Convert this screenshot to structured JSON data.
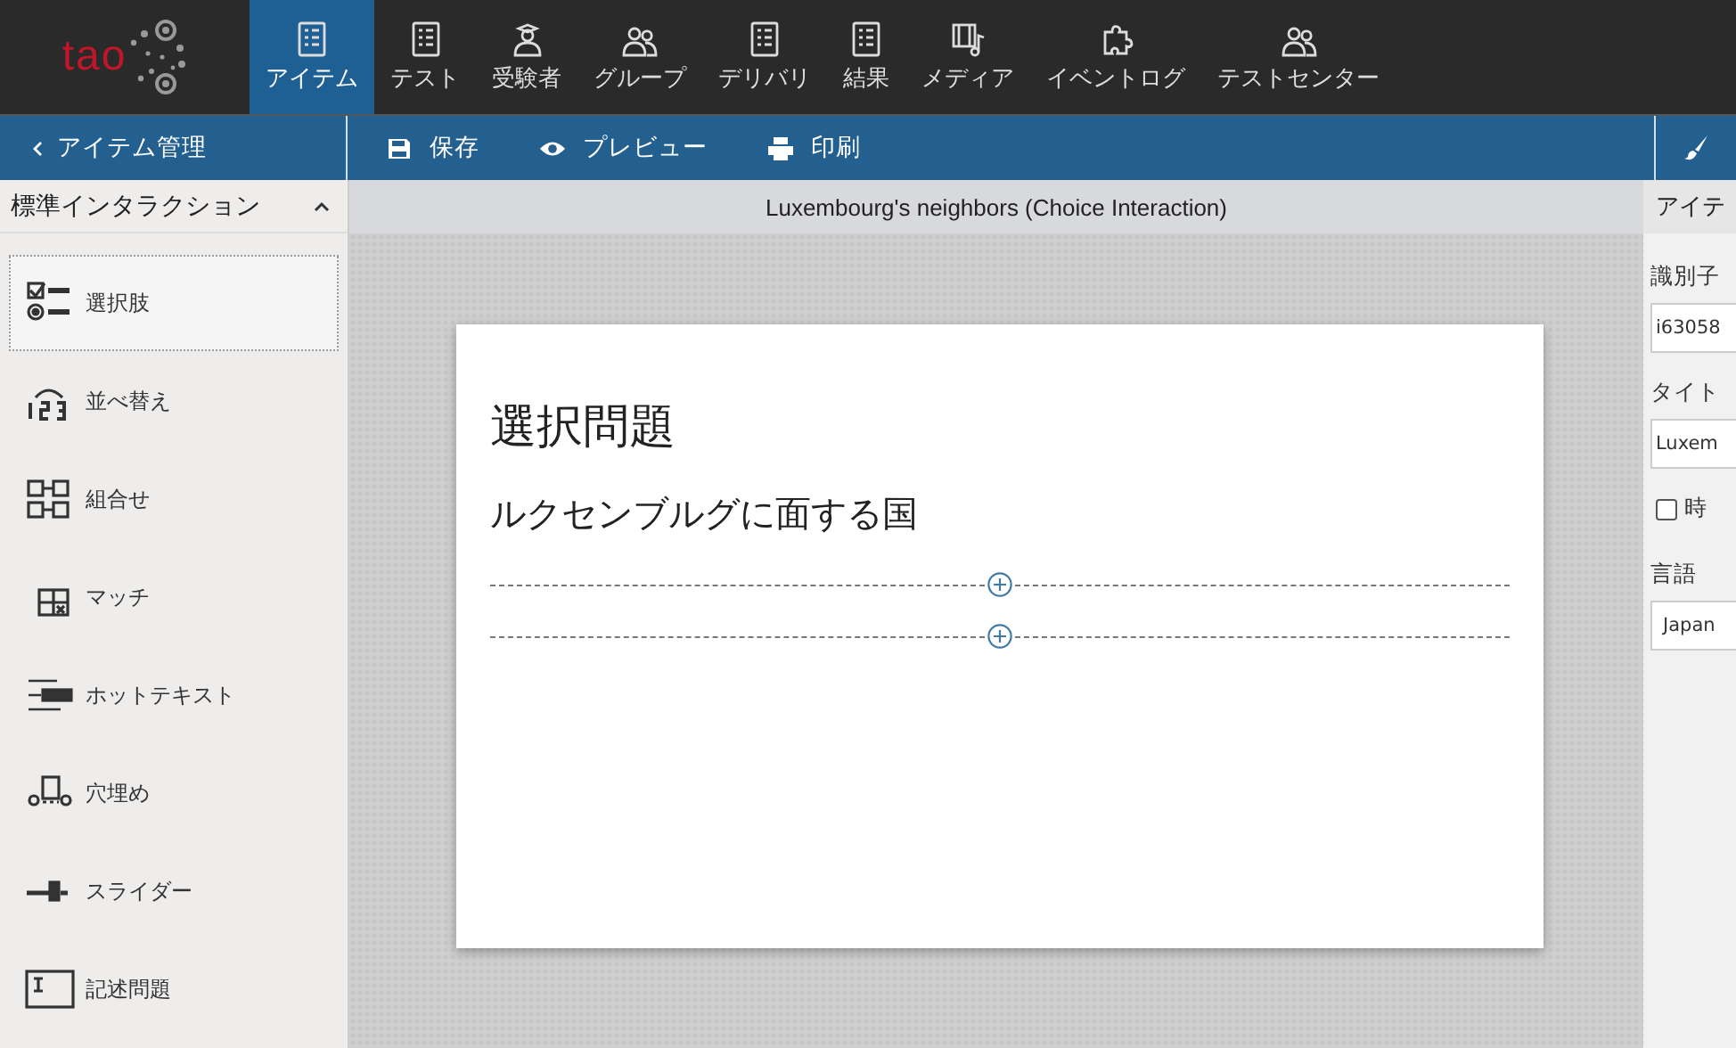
{
  "logo": {
    "text": "tao"
  },
  "nav": [
    {
      "label": "アイテム",
      "selected": true
    },
    {
      "label": "テスト",
      "selected": false
    },
    {
      "label": "受験者",
      "selected": false
    },
    {
      "label": "グループ",
      "selected": false
    },
    {
      "label": "デリバリ",
      "selected": false
    },
    {
      "label": "結果",
      "selected": false
    },
    {
      "label": "メディア",
      "selected": false
    },
    {
      "label": "イベントログ",
      "selected": false
    },
    {
      "label": "テストセンター",
      "selected": false
    }
  ],
  "back_link": "アイテム管理",
  "toolbar": [
    {
      "label": "保存"
    },
    {
      "label": "プレビュー"
    },
    {
      "label": "印刷"
    }
  ],
  "sidebar": {
    "title": "標準インタラクション",
    "expanded": true,
    "items": [
      {
        "label": "選択肢",
        "selected": true
      },
      {
        "label": "並べ替え",
        "selected": false
      },
      {
        "label": "組合せ",
        "selected": false
      },
      {
        "label": "マッチ",
        "selected": false
      },
      {
        "label": "ホットテキスト",
        "selected": false
      },
      {
        "label": "穴埋め",
        "selected": false
      },
      {
        "label": "スライダー",
        "selected": false
      },
      {
        "label": "記述問題",
        "selected": false
      }
    ]
  },
  "item_title": "Luxembourg's neighbors (Choice Interaction)",
  "card": {
    "heading": "選択問題",
    "prompt": "ルクセンブルグに面する国"
  },
  "properties": {
    "title": "アイテ",
    "identifier_label": "識別子",
    "identifier_value": "i63058",
    "title_label": "タイト",
    "title_value": "Luxem",
    "timed_label": "時",
    "timed_checked": false,
    "language_label": "言語",
    "language_value": "Japan"
  }
}
